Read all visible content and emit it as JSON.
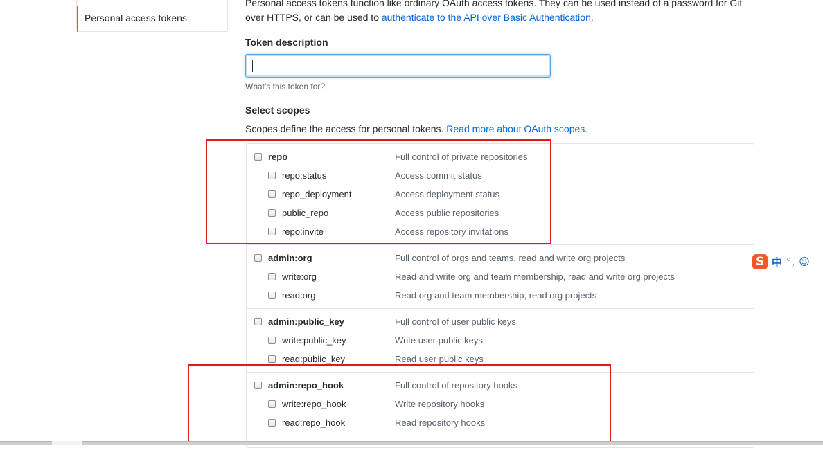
{
  "sidebar": {
    "active_item": "Personal access tokens"
  },
  "intro": {
    "text": "Personal access tokens function like ordinary OAuth access tokens. They can be used instead of a password for Git over HTTPS, or can be used to ",
    "link": "authenticate to the API over Basic Authentication",
    "end": "."
  },
  "token": {
    "label": "Token description",
    "value": "",
    "note": "What's this token for?"
  },
  "scopes": {
    "title": "Select scopes",
    "description": "Scopes define the access for personal tokens. ",
    "link": "Read more about OAuth scopes.",
    "groups": [
      {
        "name": "repo",
        "desc": "Full control of private repositories",
        "children": [
          {
            "name": "repo:status",
            "desc": "Access commit status"
          },
          {
            "name": "repo_deployment",
            "desc": "Access deployment status"
          },
          {
            "name": "public_repo",
            "desc": "Access public repositories"
          },
          {
            "name": "repo:invite",
            "desc": "Access repository invitations"
          }
        ]
      },
      {
        "name": "admin:org",
        "desc": "Full control of orgs and teams, read and write org projects",
        "children": [
          {
            "name": "write:org",
            "desc": "Read and write org and team membership, read and write org projects"
          },
          {
            "name": "read:org",
            "desc": "Read org and team membership, read org projects"
          }
        ]
      },
      {
        "name": "admin:public_key",
        "desc": "Full control of user public keys",
        "children": [
          {
            "name": "write:public_key",
            "desc": "Write user public keys"
          },
          {
            "name": "read:public_key",
            "desc": "Read user public keys"
          }
        ]
      },
      {
        "name": "admin:repo_hook",
        "desc": "Full control of repository hooks",
        "children": [
          {
            "name": "write:repo_hook",
            "desc": "Write repository hooks"
          },
          {
            "name": "read:repo_hook",
            "desc": "Read repository hooks"
          }
        ]
      }
    ]
  },
  "ime": {
    "logo": "S",
    "mode": "中",
    "punct": "°,",
    "emoji": "☺"
  },
  "colors": {
    "link": "#0366d6",
    "highlight": "#e5191a",
    "sidebar_accent": "#e36209",
    "focus": "#51a7e8"
  }
}
